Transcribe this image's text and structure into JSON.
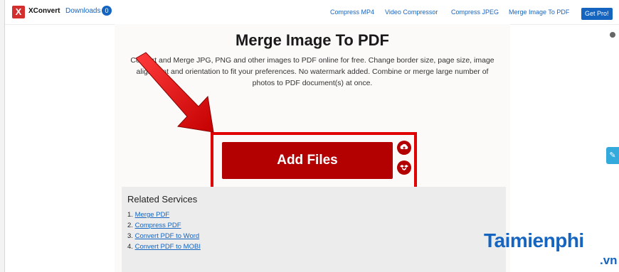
{
  "header": {
    "logo_letter": "X",
    "brand": "XConvert",
    "downloads_label": "Downloads",
    "downloads_count": "0",
    "nav": [
      "Compress MP4",
      "Video Compressor",
      "Compress JPEG",
      "Merge Image To PDF"
    ],
    "get_pro": "Get Pro!"
  },
  "main": {
    "title": "Merge Image To PDF",
    "description": "Convert and Merge JPG, PNG and other images to PDF online for free. Change border size, page size, image alignment and orientation to fit your preferences. No watermark added. Combine or merge large number of photos to PDF document(s) at once.",
    "add_files_label": "Add Files",
    "upload_icons": [
      "cloud-upload-icon",
      "dropbox-icon"
    ]
  },
  "related": {
    "title": "Related Services",
    "items": [
      {
        "num": "1.",
        "label": "Merge PDF"
      },
      {
        "num": "2.",
        "label": "Compress PDF"
      },
      {
        "num": "3.",
        "label": "Convert PDF to Word"
      },
      {
        "num": "4.",
        "label": "Convert PDF to MOBI"
      }
    ]
  },
  "watermark": {
    "text": "Taimienphi",
    "suffix": ".vn"
  },
  "colors": {
    "accent_red": "#b30000",
    "highlight_red": "#e00000",
    "link_blue": "#1565c0"
  }
}
